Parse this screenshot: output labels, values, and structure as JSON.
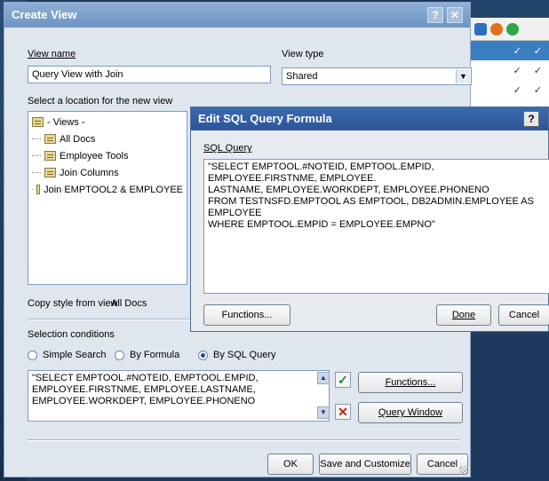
{
  "create_view": {
    "title": "Create View",
    "help_btn": "?",
    "close_btn": "✕",
    "view_name_label": "View name",
    "view_name_value": "Query View with Join",
    "view_type_label": "View type",
    "view_type_value": "Shared",
    "location_label": "Select a location for the new view",
    "tree": {
      "root": "- Views -",
      "items": [
        "All Docs",
        "Employee Tools",
        "Join Columns",
        "Join EMPTOOL2 & EMPLOYEE"
      ]
    },
    "copy_style_label": "Copy style from view",
    "copy_style_value": "All Docs",
    "selection_conditions_label": "Selection conditions",
    "radios": [
      "Simple Search",
      "By Formula",
      "By SQL Query"
    ],
    "selected_radio": "By SQL Query",
    "query_text": "\"SELECT EMPTOOL.#NOTEID, EMPTOOL.EMPID,\nEMPLOYEE.FIRSTNME, EMPLOYEE.LASTNAME,\nEMPLOYEE.WORKDEPT, EMPLOYEE.PHONENO",
    "accept_glyph": "✓",
    "reject_glyph": "✕",
    "functions_btn": "Functions...",
    "query_window_btn": "Query Window",
    "ok_btn": "OK",
    "save_customize_btn": "Save and Customize",
    "cancel_btn": "Cancel"
  },
  "sql_dialog": {
    "title": "Edit SQL Query Formula",
    "help_btn": "?",
    "sql_query_label": "SQL Query",
    "sql_text": "\"SELECT EMPTOOL.#NOTEID, EMPTOOL.EMPID, EMPLOYEE.FIRSTNME, EMPLOYEE.\nLASTNAME, EMPLOYEE.WORKDEPT, EMPLOYEE.PHONENO\nFROM TESTNSFD.EMPTOOL AS EMPTOOL, DB2ADMIN.EMPLOYEE AS EMPLOYEE\nWHERE EMPTOOL.EMPID = EMPLOYEE.EMPNO\"",
    "functions_btn": "Functions...",
    "done_btn": "Done",
    "cancel_btn": "Cancel"
  },
  "background_app": {
    "check_mark": "✓"
  },
  "colors": {
    "titlebar_create_view": "#7fa2cd",
    "titlebar_sql": "#2f5b9e",
    "selected_row": "#3c7fc1"
  }
}
